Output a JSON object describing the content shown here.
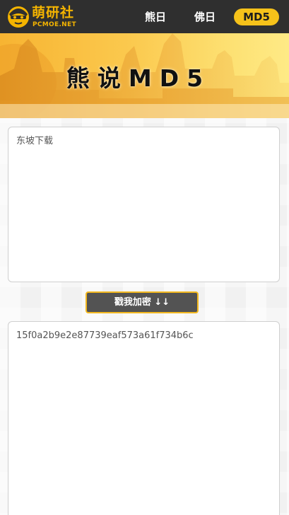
{
  "brand": {
    "name_cn": "萌研社",
    "name_en": "PCMOE.NET"
  },
  "nav": {
    "items": [
      {
        "label": "熊日",
        "active": false
      },
      {
        "label": "佛日",
        "active": false
      },
      {
        "label": "MD5",
        "active": true
      }
    ]
  },
  "banner": {
    "title": "熊说MD5"
  },
  "input": {
    "value": "东坡下载"
  },
  "action": {
    "label": "戳我加密 ↓↓"
  },
  "output": {
    "value": "15f0a2b9e2e87739eaf573a61f734b6c"
  },
  "colors": {
    "topbar": "#2f2f2f",
    "accent": "#f6c21a",
    "button": "#535353"
  }
}
